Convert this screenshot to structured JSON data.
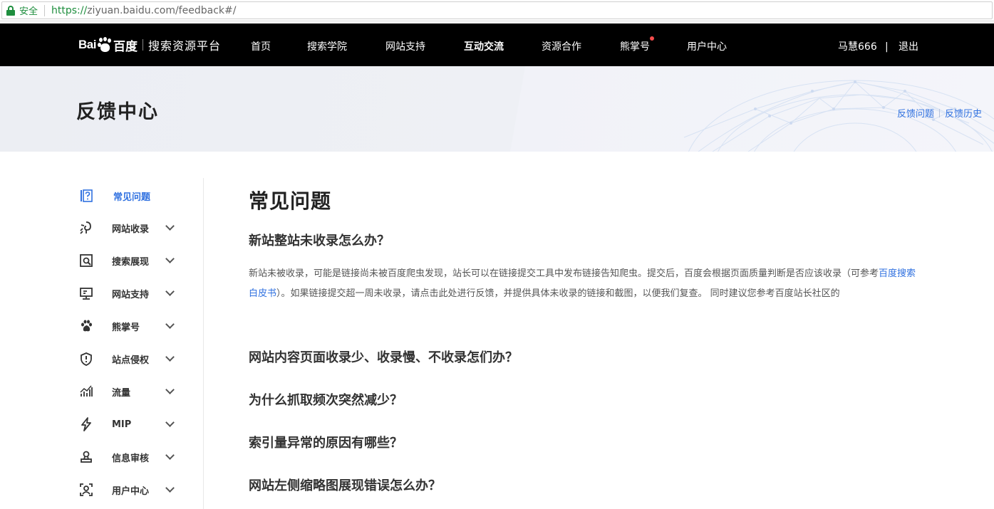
{
  "address_bar": {
    "secure_label": "安全",
    "url_scheme": "https://",
    "url_rest": "ziyuan.baidu.com/feedback#/"
  },
  "nav": {
    "logo_bai": "Bai",
    "logo_du": "百度",
    "logo_platform": "搜索资源平台",
    "items": [
      {
        "label": "首页"
      },
      {
        "label": "搜索学院"
      },
      {
        "label": "网站支持"
      },
      {
        "label": "互动交流"
      },
      {
        "label": "资源合作"
      },
      {
        "label": "熊掌号"
      },
      {
        "label": "用户中心"
      }
    ],
    "active_item": "互动交流",
    "username": "马慧666",
    "separator": "|",
    "logout": "退出"
  },
  "banner": {
    "title": "反馈中心",
    "links": [
      "反馈问题",
      "反馈历史"
    ]
  },
  "sidebar": {
    "items": [
      {
        "label": "常见问题",
        "icon": "help-icon"
      },
      {
        "label": "网站收录",
        "icon": "spider-icon"
      },
      {
        "label": "搜索展现",
        "icon": "search-display-icon"
      },
      {
        "label": "网站支持",
        "icon": "monitor-icon"
      },
      {
        "label": "熊掌号",
        "icon": "paw-icon"
      },
      {
        "label": "站点侵权",
        "icon": "shield-icon"
      },
      {
        "label": "流量",
        "icon": "chart-icon"
      },
      {
        "label": "MIP",
        "icon": "lightning-icon"
      },
      {
        "label": "信息审核",
        "icon": "stamp-icon"
      },
      {
        "label": "用户中心",
        "icon": "user-card-icon"
      }
    ]
  },
  "main": {
    "title": "常见问题",
    "questions": [
      {
        "title": "新站整站未收录怎么办？"
      },
      {
        "title": "网站内容页面收录少、收录慢、不收录怎们办？"
      },
      {
        "title": "为什么抓取频次突然减少？"
      },
      {
        "title": "索引量异常的原因有哪些？"
      },
      {
        "title": "网站左侧缩略图展现错误怎么办？"
      }
    ],
    "answer": {
      "part1": "新站未被收录，可能是链接尚未被百度爬虫发现，站长可以在链接提交工具中发布链接告知爬虫。提交后，百度会根据页面质量判断是否应该收录（可参考",
      "link": "百度搜索白皮书",
      "part2": "）。如果链接提交超一周未收录，请点击此处进行反馈，并提供具体未收录的链接和截图，以便我们复查。 同时建议您参考百度站长社区的"
    }
  },
  "colors": {
    "nav_bg": "#000000",
    "accent": "#3071e0",
    "secure_green": "#1e8e3e",
    "notification_dot": "#f54c4c"
  }
}
